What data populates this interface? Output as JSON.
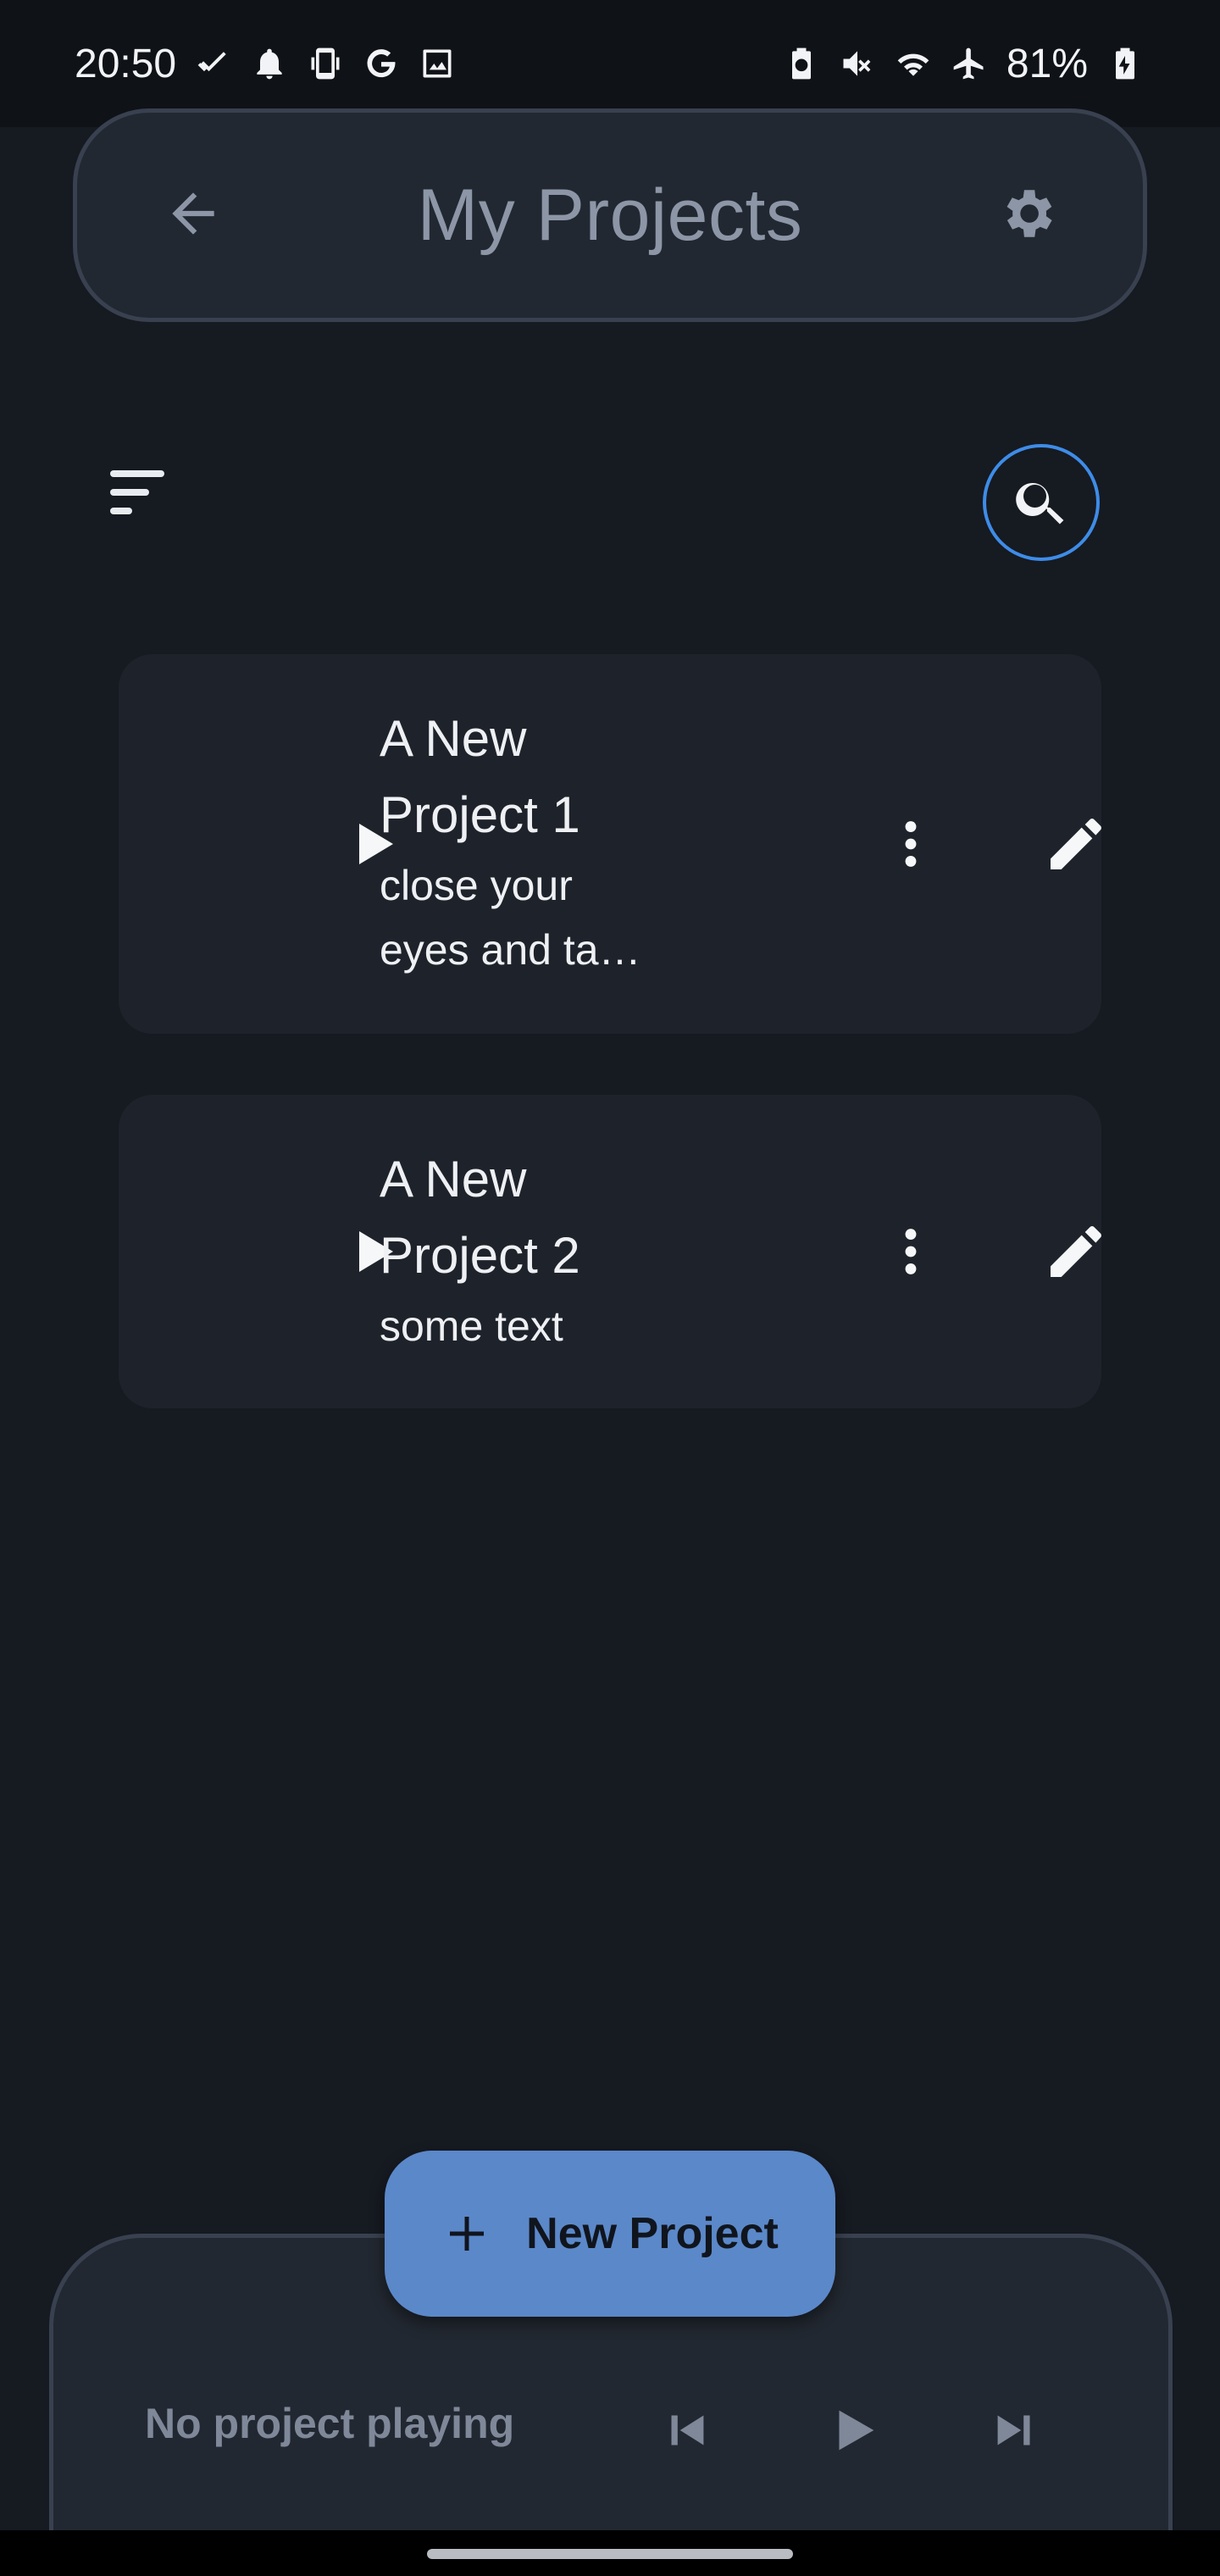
{
  "status_bar": {
    "time": "20:50",
    "left_icons": [
      "check-double-icon",
      "bell-icon",
      "device-icon",
      "google-icon",
      "image-icon"
    ],
    "right_icons": [
      "battery-saver-icon",
      "mute-icon",
      "wifi-icon",
      "airplane-icon"
    ],
    "battery": "81%"
  },
  "app_bar": {
    "title": "My Projects"
  },
  "projects": [
    {
      "name": "A New Project 1",
      "description": "close your eyes and ta…"
    },
    {
      "name": "A New Project 2",
      "description": "some text"
    }
  ],
  "fab": {
    "label": "New Project"
  },
  "player": {
    "status": "No project playing"
  },
  "colors": {
    "background": "#161a21",
    "surface": "#222831",
    "card": "#1e232b",
    "accent": "#5b88c9",
    "search_ring": "#3e8ce8"
  }
}
